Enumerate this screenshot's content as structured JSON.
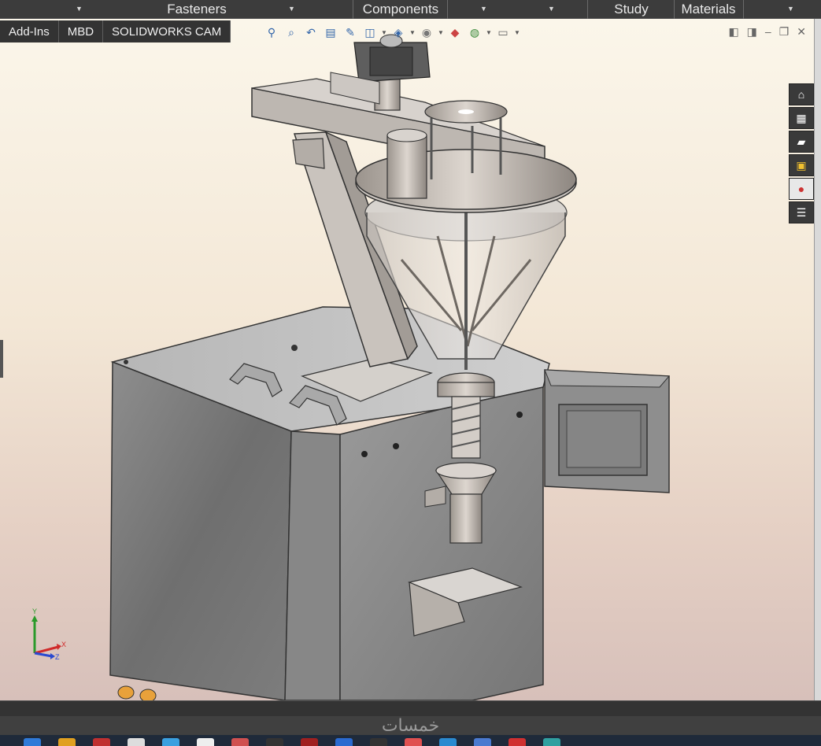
{
  "ribbon": {
    "groups": [
      {
        "label": "Fasteners"
      },
      {
        "label": "Components"
      },
      {
        "label": "Study"
      },
      {
        "label": "Materials"
      }
    ]
  },
  "tabs": [
    {
      "label": "Add-Ins"
    },
    {
      "label": "MBD"
    },
    {
      "label": "SOLIDWORKS CAM"
    }
  ],
  "view_toolbar": {
    "icons": [
      "zoom-to-fit-icon",
      "zoom-to-area-icon",
      "previous-view-icon",
      "section-view-icon",
      "dynamic-annotation-icon",
      "view-orientation-icon",
      "display-style-icon",
      "hide-show-icon",
      "edit-appearance-icon",
      "apply-scene-icon",
      "view-settings-icon"
    ]
  },
  "task_pane": {
    "icons": [
      "home-icon",
      "parts-library-icon",
      "file-explorer-icon",
      "view-palette-icon",
      "appearances-icon",
      "custom-properties-icon"
    ]
  },
  "triad": {
    "x_label": "X",
    "y_label": "Y",
    "z_label": "Z"
  },
  "watermark": "خمسات",
  "colors": {
    "ribbon_bg": "#3c3c3c",
    "viewport_top": "#fbf6ea",
    "viewport_bottom": "#d7c0ba",
    "metal": "#8a8a8a"
  }
}
